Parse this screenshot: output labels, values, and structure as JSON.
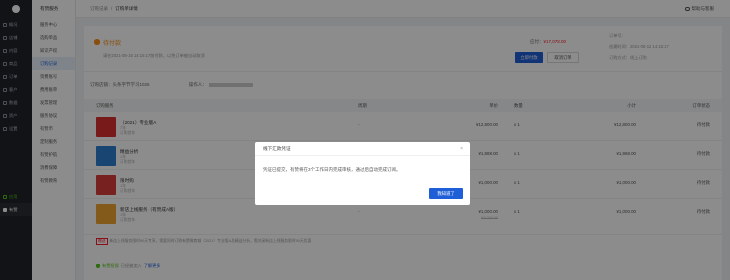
{
  "nav_primary": [
    {
      "label": "概况"
    },
    {
      "label": "店铺"
    },
    {
      "label": "内容"
    },
    {
      "label": "商品"
    },
    {
      "label": "订单"
    },
    {
      "label": "客户"
    },
    {
      "label": "数据"
    },
    {
      "label": "资产"
    },
    {
      "label": "设置"
    }
  ],
  "nav_primary_bottom": [
    {
      "label": "应用"
    },
    {
      "label": "有赞"
    }
  ],
  "nav_secondary": {
    "title": "有赞服务",
    "items": [
      {
        "label": "服务中心"
      },
      {
        "label": "选购单品"
      },
      {
        "label": "知识产权"
      },
      {
        "label": "订购记录"
      },
      {
        "label": "资费账号"
      },
      {
        "label": "费用账单"
      },
      {
        "label": "发票管理"
      },
      {
        "label": "服务协议"
      },
      {
        "label": "有赞币"
      },
      {
        "label": "定制服务"
      },
      {
        "label": "有赞护航"
      },
      {
        "label": "消费保障"
      },
      {
        "label": "有赞教育"
      }
    ]
  },
  "breadcrumb": {
    "parent": "订购记录",
    "sep": "/",
    "current": "订购单详情"
  },
  "help": {
    "label": "帮助与客服"
  },
  "order_status": {
    "title": "待付款",
    "desc": "请在2021-06-15 14:15:17前付款，以免订单被自动取消",
    "pay_label": "应付：",
    "pay_amount": "¥17,078.00",
    "pay_button": "立即付款",
    "cancel_button": "取消订单",
    "meta": [
      "订单号：",
      "创建时间：2021-06-12 14:15:17",
      "订购方式：线上订购"
    ]
  },
  "order_info": {
    "store_label": "订购店铺：",
    "store_value": "头条字节学习1025",
    "account_label": "操作人："
  },
  "table": {
    "headers": [
      "订购服务",
      "周期",
      "单价",
      "数量",
      "小计",
      "订单状态"
    ],
    "rows": [
      {
        "name": "（2021）专业版A",
        "sub1": "7年",
        "sub2": "订购首年",
        "period": "-",
        "price": "¥12,800.00",
        "qty": "x 1",
        "subtotal": "¥12,800.00",
        "status": "待付款",
        "color": "#d9302e"
      },
      {
        "name": "精益分析",
        "sub1": "1年",
        "sub2": "订购首年",
        "period": "-",
        "price": "¥1,988.00",
        "qty": "x 1",
        "subtotal": "¥1,988.00",
        "status": "待付款",
        "color": "#2f7fd1"
      },
      {
        "name": "限时购",
        "sub1": "1年",
        "sub2": "订购首年",
        "period": "-",
        "price": "¥1,000.00",
        "qty": "x 1",
        "subtotal": "¥1,000.00",
        "status": "待付款",
        "color": "#d93c3c"
      },
      {
        "name": "新店上线服务（有赞成A版）",
        "sub1": "1年",
        "sub2": "订购首年",
        "period": "-",
        "price": "¥1,000.00",
        "orig": "¥3,000.00",
        "qty": "x 1",
        "subtotal": "¥1,000.00",
        "status": "待付款",
        "color": "#f0a431"
      }
    ],
    "gift": {
      "tag": "赠送",
      "text": "新店上线服务限时90天专享，需要同时订购有赞微商城（2021）专业版A及精益分析，需关闭新店上线服务限时90天优惠"
    }
  },
  "service_note": {
    "title": "有赞担保",
    "text": "已经被加入",
    "link": "了解更多"
  },
  "modal": {
    "title": "线下汇款凭证",
    "close": "×",
    "body": "凭证已提交，有赞将在3个工作日内完成审核，通过后自动完成订阅。",
    "ok": "我知道了"
  }
}
